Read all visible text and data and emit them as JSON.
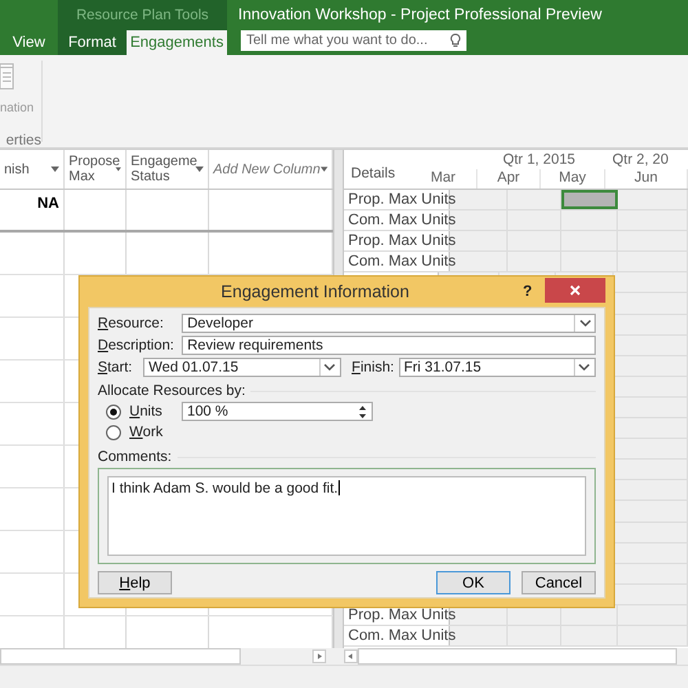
{
  "window": {
    "title": "Innovation Workshop - Project Professional Preview",
    "contextual_group": "Resource Plan Tools"
  },
  "tabs": [
    {
      "label": "View",
      "kind": "plain",
      "selected": false
    },
    {
      "label": "Format",
      "kind": "contextual",
      "selected": false
    },
    {
      "label": "Engagements",
      "kind": "contextual",
      "selected": true
    }
  ],
  "search": {
    "placeholder": "Tell me what you want to do..."
  },
  "ribbon": {
    "button_label": "nation",
    "group_label": "erties"
  },
  "table": {
    "columns": [
      "nish",
      "Propose Max",
      "Engageme Status",
      "Add New Column"
    ],
    "rows": [
      [
        "NA"
      ]
    ]
  },
  "timescale": {
    "tiers": [
      "Qtr 1, 2015",
      "Qtr 2, 20"
    ],
    "months": [
      "Mar",
      "Apr",
      "May",
      "Jun"
    ]
  },
  "details": {
    "header": "Details",
    "rows_top": [
      {
        "label": "Prop. Max Units",
        "cells": [
          {
            "selected": false
          },
          {
            "selected": false
          },
          {
            "selected": true
          },
          {
            "selected": false
          }
        ]
      },
      {
        "label": "Com. Max Units",
        "cells": [
          {
            "selected": false
          },
          {
            "selected": false
          },
          {
            "selected": false
          },
          {
            "selected": false
          }
        ]
      },
      {
        "label": "Prop. Max Units",
        "cells": [
          {
            "selected": false
          },
          {
            "selected": false
          },
          {
            "selected": false
          },
          {
            "selected": false
          }
        ]
      },
      {
        "label": "Com. Max Units",
        "cells": [
          {
            "selected": false
          },
          {
            "selected": false
          },
          {
            "selected": false
          },
          {
            "selected": false
          }
        ]
      }
    ],
    "rows_bottom": [
      "Prop. Max Units",
      "Com. Max Units"
    ]
  },
  "dialog": {
    "title": "Engagement Information",
    "help_glyph": "?",
    "resource": {
      "label": "Resource:",
      "value": "Developer"
    },
    "description": {
      "label": "Description:",
      "value": "Review requirements"
    },
    "start": {
      "label": "Start:",
      "value": "Wed 01.07.15"
    },
    "finish": {
      "label": "Finish:",
      "value": "Fri 31.07.15"
    },
    "allocate_label": "Allocate Resources by:",
    "allocate_options": [
      {
        "label": "Units",
        "selected": true
      },
      {
        "label": "Work",
        "selected": false
      }
    ],
    "units_value": "100 %",
    "comments_label": "Comments:",
    "comments": "I think Adam S. would be a good fit.",
    "buttons": [
      {
        "label": "Help",
        "default": false
      },
      {
        "label": "OK",
        "default": true
      },
      {
        "label": "Cancel",
        "default": false
      }
    ]
  }
}
